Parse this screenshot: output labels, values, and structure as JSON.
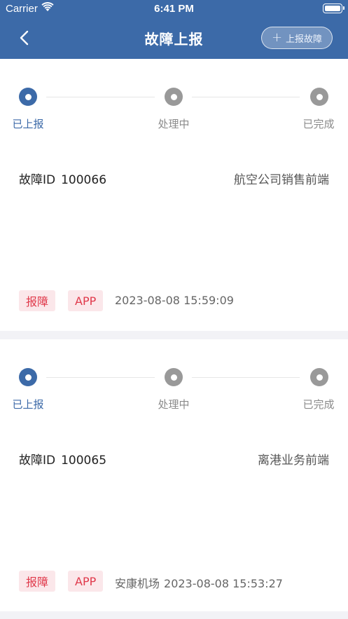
{
  "status_bar": {
    "carrier": "Carrier",
    "time": "6:41 PM"
  },
  "nav": {
    "title": "故障上报",
    "report_button": "上报故障"
  },
  "steps": [
    "已上报",
    "处理中",
    "已完成"
  ],
  "labels": {
    "fault_id": "故障ID"
  },
  "colors": {
    "primary": "#3c6aa8",
    "tag_bg": "#fbe7ea",
    "tag_text": "#e0394b",
    "inactive_step": "#999999"
  },
  "reports": [
    {
      "id": "100066",
      "department": "航空公司销售前端",
      "tags": [
        "报障",
        "APP"
      ],
      "location": "",
      "datetime": "2023-08-08 15:59:09",
      "current_step": 0
    },
    {
      "id": "100065",
      "department": "离港业务前端",
      "tags": [
        "报障",
        "APP"
      ],
      "location": "安康机场",
      "datetime": "2023-08-08 15:53:27",
      "current_step": 0
    }
  ]
}
